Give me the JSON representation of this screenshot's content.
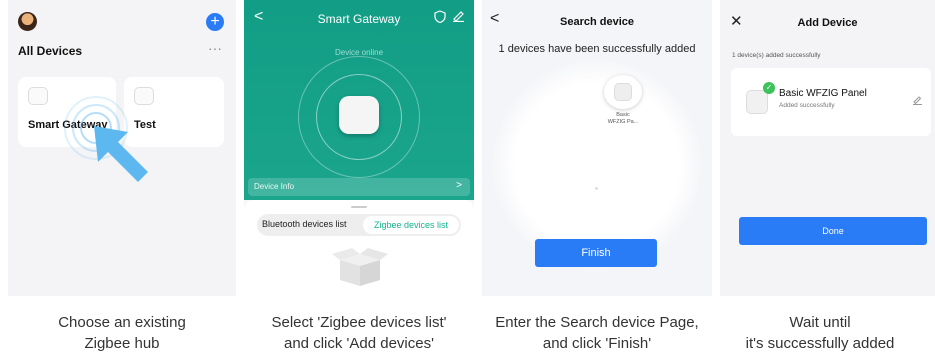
{
  "panel1": {
    "title": "All Devices",
    "add_icon": "+",
    "more_icon": "···",
    "devices": [
      {
        "name": "Smart Gateway"
      },
      {
        "name": "Test"
      }
    ],
    "caption_line1": "Choose an existing",
    "caption_line2": "Zigbee hub",
    "accent": "#2a7cf6"
  },
  "panel2": {
    "title": "Smart Gateway",
    "back_icon": "<",
    "status": "Device online",
    "info_label": "Device Info",
    "info_chevron": ">",
    "tabs": [
      {
        "label": "Bluetooth devices list",
        "active": false
      },
      {
        "label": "Zigbee devices list",
        "active": true
      }
    ],
    "caption_line1": "Select 'Zigbee devices list'",
    "caption_line2": "and click 'Add devices'",
    "theme": "#129e86"
  },
  "panel3": {
    "title": "Search device",
    "back_icon": "<",
    "message": "1 devices have been successfully added",
    "device_label_line1": "Basic",
    "device_label_line2": "WFZIG Pa...",
    "finish_label": "Finish",
    "caption_line1": "Enter the Search device Page,",
    "caption_line2": "and click 'Finish'"
  },
  "panel4": {
    "title": "Add Device",
    "close_icon": "✕",
    "count_text": "1 device(s) added successfully",
    "device_name": "Basic WFZIG Panel",
    "device_status": "Added successfully",
    "check_icon": "✓",
    "done_label": "Done",
    "caption_line1": "Wait until",
    "caption_line2": "it's successfully added"
  }
}
